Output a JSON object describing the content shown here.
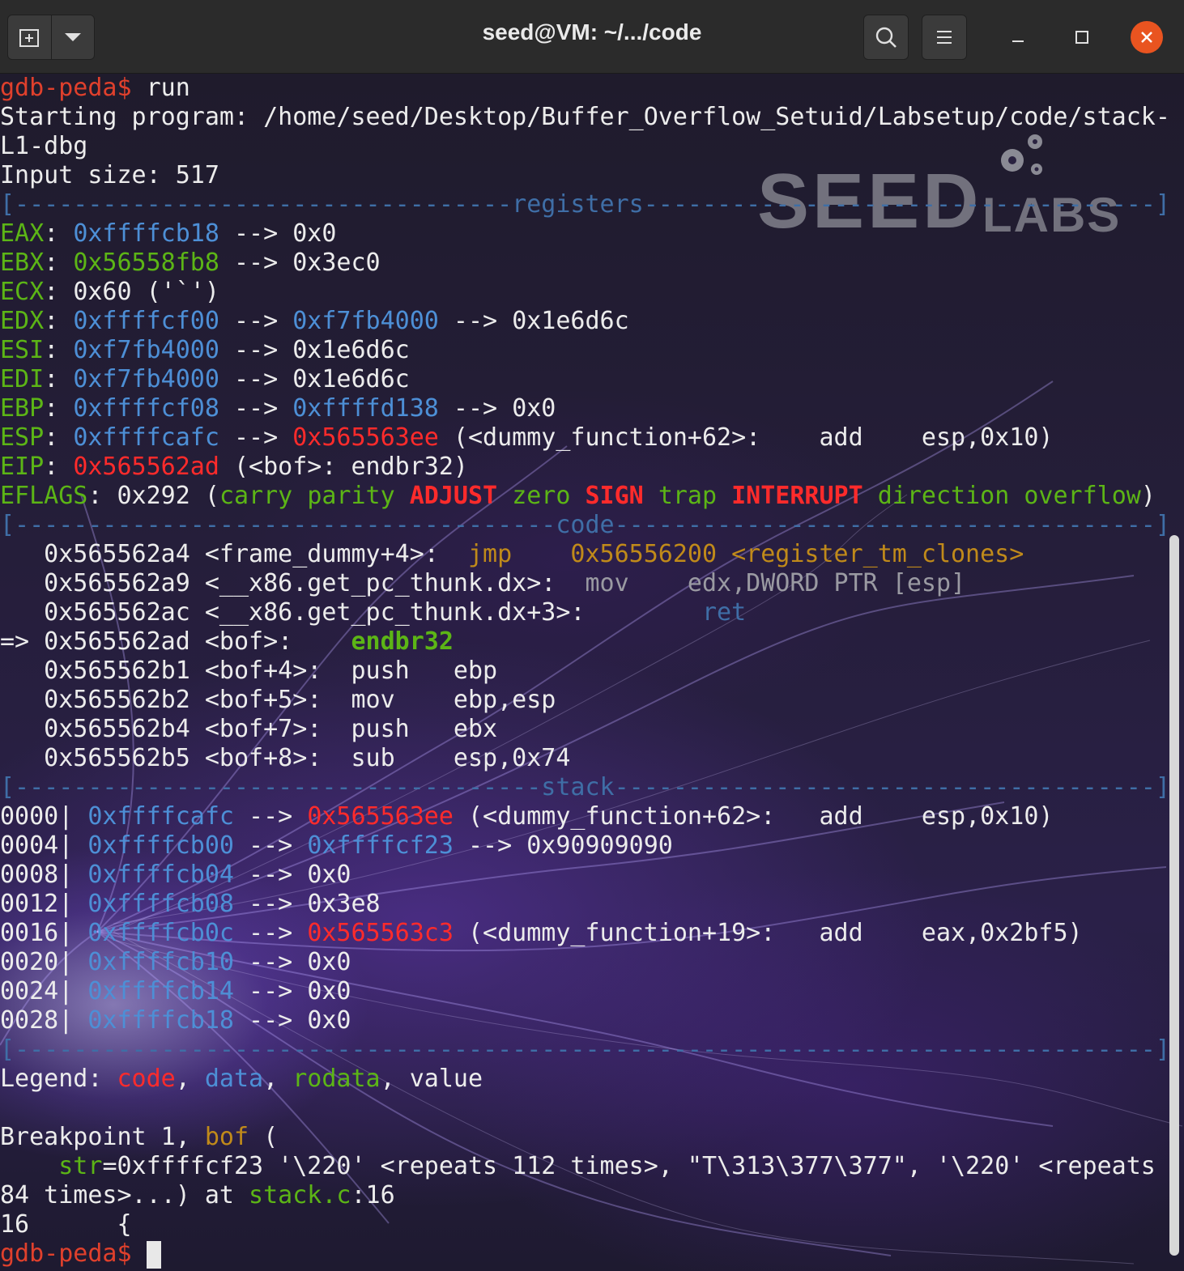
{
  "window": {
    "title": "seed@VM: ~/.../code",
    "new_tab_icon": "new-tab-icon",
    "dropdown_icon": "chevron-down-icon",
    "search_icon": "search-icon",
    "menu_icon": "hamburger-menu-icon",
    "minimize_icon": "minimize-icon",
    "maximize_icon": "maximize-icon",
    "close_icon": "close-icon",
    "close_color": "#e95420"
  },
  "logo": {
    "main": "SEED",
    "sub": "LABS"
  },
  "terminal": {
    "prompt": "gdb-peda$",
    "command": " run",
    "starting_line1": "Starting program: /home/seed/Desktop/Buffer_Overflow_Setuid/Labsetup/code/stack-",
    "starting_line2": "L1-dbg",
    "input_size": "Input size: 517",
    "sections": {
      "registers_left": "[----------------------------------",
      "registers_label": "registers",
      "registers_right": "-----------------------------------]",
      "code_left": "[-------------------------------------",
      "code_label": "code",
      "code_right": "-------------------------------------]",
      "stack_left": "[------------------------------------",
      "stack_label": "stack",
      "stack_right": "-------------------------------------]",
      "end": "[------------------------------------------------------------------------------]"
    },
    "registers": {
      "eax": {
        "name": "EAX",
        "addr": "0xffffcb18",
        "arrow": " --> ",
        "val": "0x0"
      },
      "ebx": {
        "name": "EBX",
        "addr": "0x56558fb8",
        "arrow": " --> ",
        "val": "0x3ec0"
      },
      "ecx": {
        "name": "ECX",
        "val": "0x60 ('`')"
      },
      "edx": {
        "name": "EDX",
        "addr": "0xffffcf00",
        "arrow": " --> ",
        "addr2": "0xf7fb4000",
        "val": "0x1e6d6c"
      },
      "esi": {
        "name": "ESI",
        "addr": "0xf7fb4000",
        "arrow": " --> ",
        "val": "0x1e6d6c"
      },
      "edi": {
        "name": "EDI",
        "addr": "0xf7fb4000",
        "arrow": " --> ",
        "val": "0x1e6d6c"
      },
      "ebp": {
        "name": "EBP",
        "addr": "0xffffcf08",
        "arrow": " --> ",
        "addr2": "0xffffd138",
        "val": "0x0"
      },
      "esp": {
        "name": "ESP",
        "addr": "0xffffcafc",
        "arrow": " --> ",
        "code": "0x565563ee",
        "rest": " (<dummy_function+62>:    add    esp,0x10)"
      },
      "eip": {
        "name": "EIP",
        "code": "0x565562ad",
        "rest": " (<bof>: endbr32)"
      },
      "eflags": {
        "name": "EFLAGS",
        "val": ": 0x292 (",
        "carry": "carry",
        "parity": "parity",
        "adjust": "ADJUST",
        "zero": "zero",
        "sign": "SIGN",
        "trap": "trap",
        "interrupt": "INTERRUPT",
        "direction": "direction",
        "overflow": "overflow",
        "close": ")"
      }
    },
    "code": [
      {
        "prefix": "   0x565562a4 <frame_dummy+4>:  ",
        "instr": "jmp    0x56556200 <register_tm_clones>"
      },
      {
        "prefix": "   0x565562a9 <__x86.get_pc_thunk.dx>:  ",
        "instr": "mov    edx,DWORD PTR [esp]"
      },
      {
        "prefix": "   0x565562ac <__x86.get_pc_thunk.dx+3>:        ",
        "instr": "ret"
      },
      {
        "prefix": "=> 0x565562ad <bof>:    ",
        "instr": "endbr32"
      },
      {
        "prefix": "   0x565562b1 <bof+4>:  ",
        "instr": "push   ebp"
      },
      {
        "prefix": "   0x565562b2 <bof+5>:  ",
        "instr": "mov    ebp,esp"
      },
      {
        "prefix": "   0x565562b4 <bof+7>:  ",
        "instr": "push   ebx"
      },
      {
        "prefix": "   0x565562b5 <bof+8>:  ",
        "instr": "sub    esp,0x74"
      }
    ],
    "stack": [
      {
        "off": "0000| ",
        "addr": "0xffffcafc",
        "arrow": " --> ",
        "code": "0x565563ee",
        "rest": " (<dummy_function+62>:   add    esp,0x10)"
      },
      {
        "off": "0004| ",
        "addr": "0xffffcb00",
        "arrow": " --> ",
        "addr2": "0xffffcf23",
        "rest": " --> 0x90909090"
      },
      {
        "off": "0008| ",
        "addr": "0xffffcb04",
        "arrow": " --> ",
        "rest": "0x0"
      },
      {
        "off": "0012| ",
        "addr": "0xffffcb08",
        "arrow": " --> ",
        "rest": "0x3e8"
      },
      {
        "off": "0016| ",
        "addr": "0xffffcb0c",
        "arrow": " --> ",
        "code": "0x565563c3",
        "rest": " (<dummy_function+19>:   add    eax,0x2bf5)"
      },
      {
        "off": "0020| ",
        "addr": "0xffffcb10",
        "arrow": " --> ",
        "rest": "0x0"
      },
      {
        "off": "0024| ",
        "addr": "0xffffcb14",
        "arrow": " --> ",
        "rest": "0x0"
      },
      {
        "off": "0028| ",
        "addr": "0xffffcb18",
        "arrow": " --> ",
        "rest": "0x0"
      }
    ],
    "legend": {
      "label": "Legend: ",
      "code": "code",
      "data": "data",
      "rodata": "rodata",
      "value": "value",
      "sep": ", "
    },
    "breakpoint": {
      "line1_a": "Breakpoint 1, ",
      "func": "bof",
      "line1_b": " (",
      "indent": "    ",
      "param": "str",
      "line2_b": "=0xffffcf23 '\\220' <repeats 112 times>, \"T\\313\\377\\377\", '\\220' <repeats",
      "line3_a": "84 times>...) at ",
      "file": "stack.c",
      "line3_b": ":16",
      "src": "16\t{"
    }
  }
}
